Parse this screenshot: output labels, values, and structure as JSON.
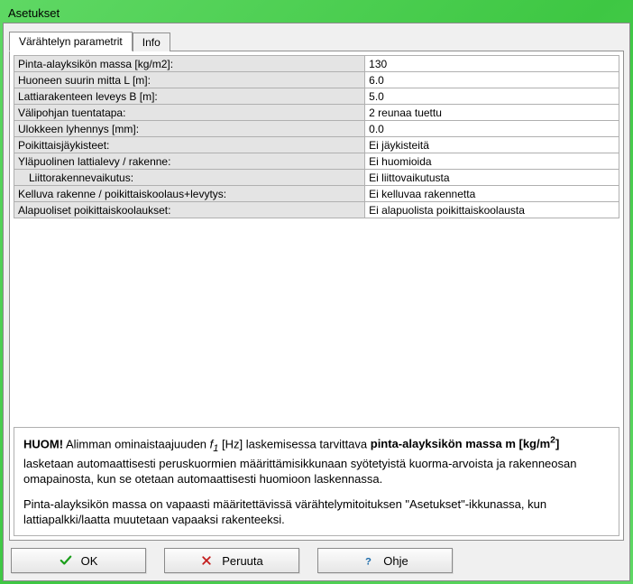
{
  "window": {
    "title": "Asetukset"
  },
  "tabs": [
    {
      "label": "Värähtelyn parametrit",
      "active": true
    },
    {
      "label": "Info",
      "active": false
    }
  ],
  "properties": [
    {
      "label": "Pinta-alayksikön massa [kg/m2]:",
      "value": "130"
    },
    {
      "label": "Huoneen suurin mitta L [m]:",
      "value": "6.0"
    },
    {
      "label": "Lattiarakenteen leveys B [m]:",
      "value": "5.0"
    },
    {
      "label": "Välipohjan tuentatapa:",
      "value": "2 reunaa tuettu"
    },
    {
      "label": "Ulokkeen lyhennys [mm]:",
      "value": "0.0"
    },
    {
      "label": "Poikittaisjäykisteet:",
      "value": "Ei jäykisteitä"
    },
    {
      "label": "Yläpuolinen lattialevy / rakenne:",
      "value": "Ei huomioida"
    },
    {
      "label": "Liittorakennevaikutus:",
      "value": "Ei liittovaikutusta",
      "indent": true
    },
    {
      "label": "Kelluva rakenne / poikittaiskoolaus+levytys:",
      "value": "Ei kelluvaa rakennetta"
    },
    {
      "label": "Alapuoliset poikittaiskoolaukset:",
      "value": "Ei alapuolista poikittaiskoolausta"
    }
  ],
  "note": {
    "p1_prefix": "HUOM!",
    "p1_mid1": " Alimman ominaistaajuuden ",
    "p1_f": "f",
    "p1_sub": "1",
    "p1_mid2": " [Hz] laskemisessa tarvittava ",
    "p1_bold2a": "pinta-alayksikön massa m [kg/m",
    "p1_sup": "2",
    "p1_bold2b": "]",
    "p1_tail": " lasketaan automaattisesti peruskuormien määrittämisikkunaan syötetyistä kuorma-arvoista ja rakenneosan omapainosta, kun se otetaan automaattisesti huomioon laskennassa.",
    "p2": "Pinta-alayksikön massa on vapaasti määritettävissä värähtelymitoituksen \"Asetukset\"-ikkunassa, kun lattiapalkki/laatta muutetaan vapaaksi rakenteeksi."
  },
  "buttons": {
    "ok": "OK",
    "cancel": "Peruuta",
    "help": "Ohje"
  }
}
